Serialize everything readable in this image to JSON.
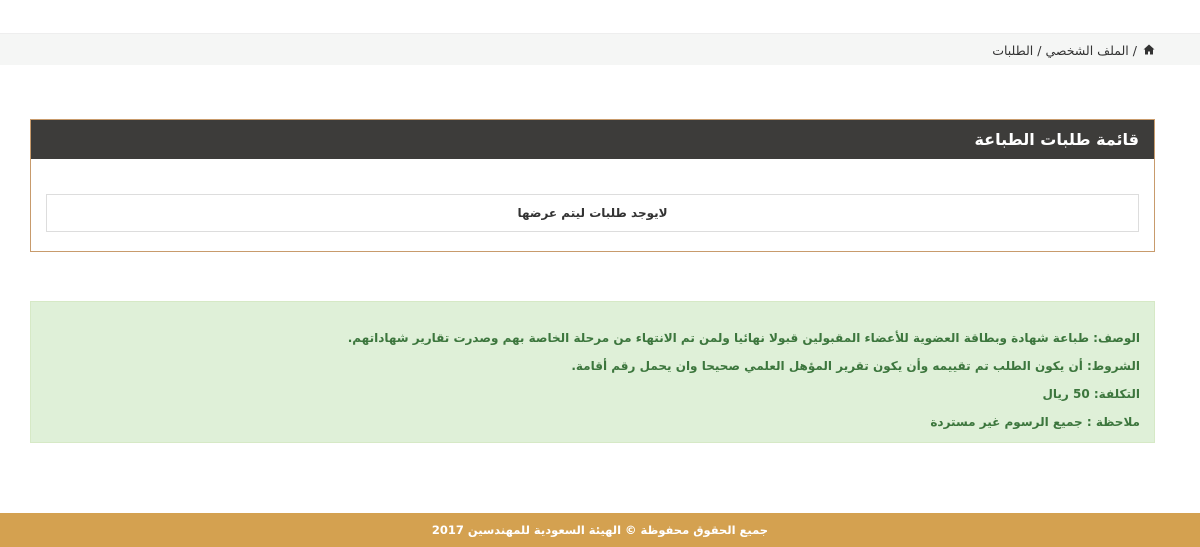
{
  "breadcrumb": {
    "home_icon": "home-icon",
    "separator_1": "/",
    "profile_label": "الملف الشخصي",
    "separator_2": "/",
    "current_label": "الطلبات"
  },
  "panel": {
    "title": "قائمة طلبات الطباعة",
    "empty_message": "لايوجد طلبات ليتم عرضها"
  },
  "info": {
    "description": "الوصف: طباعة شهادة وبطاقة العضوية للأعضاء المقبولين قبولا نهائيا ولمن تم الانتهاء من مرحلة الخاصة بهم وصدرت تقارير شهاداتهم.",
    "conditions": "الشروط: أن يكون الطلب تم تقييمه وأن يكون تقرير المؤهل العلمي صحيحا وان يحمل رقم أقامة.",
    "cost": "التكلفة: 50 ريال",
    "note": "ملاحظة : جميع الرسوم غير مستردة"
  },
  "footer": {
    "copyright": "جميع الحقوق محفوظة © الهيئة السعودية للمهندسين 2017"
  },
  "colors": {
    "panel_header": "#3d3c3a",
    "panel_border": "#c89b6c",
    "info_bg": "#dff0d8",
    "info_text": "#3c763d",
    "footer_bg": "#d4a150"
  }
}
